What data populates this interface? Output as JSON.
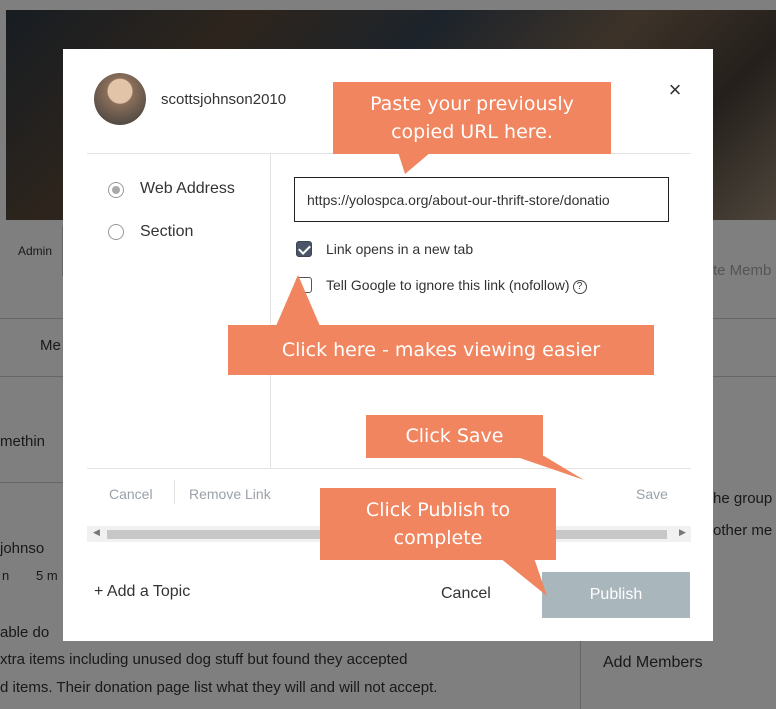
{
  "background": {
    "admin_label": "Admin",
    "right_placeholder": "te Memb",
    "tab_fragment": "Me",
    "post_fragment": "methin",
    "group_fragment": "he group",
    "members_fragment": "other me",
    "author_fragment": "johnso",
    "meta_a": "n",
    "meta_b": "5 m",
    "body_line1": "able do",
    "body_line2": "xtra items including unused dog stuff but found they accepted",
    "body_line3": "d items. Their donation page list what they will and will not accept.",
    "add_members": "Add Members"
  },
  "modal": {
    "username": "scottsjohnson2010",
    "close_symbol": "×",
    "link_types": [
      {
        "label": "Web Address",
        "selected": true
      },
      {
        "label": "Section",
        "selected": false
      }
    ],
    "url_value": "https://yolospca.org/about-our-thrift-store/donatio",
    "options": [
      {
        "label": "Link opens in a new tab",
        "checked": true
      },
      {
        "label": "Tell Google to ignore this link (nofollow)",
        "checked": false
      }
    ],
    "help_symbol": "?",
    "footer": {
      "cancel": "Cancel",
      "remove": "Remove Link",
      "save": "Save"
    },
    "add_topic": "+ Add a Topic",
    "cancel": "Cancel",
    "publish": "Publish"
  },
  "callouts": {
    "paste_line1": "Paste your previously",
    "paste_line2": "copied URL here.",
    "click_here": "Click here - makes viewing easier",
    "click_save": "Click Save",
    "publish_line1": "Click Publish to",
    "publish_line2": "complete"
  },
  "colors": {
    "callout": "#f0855f",
    "publish_button": "#a9b7bd",
    "checkbox": "#4a5568"
  }
}
